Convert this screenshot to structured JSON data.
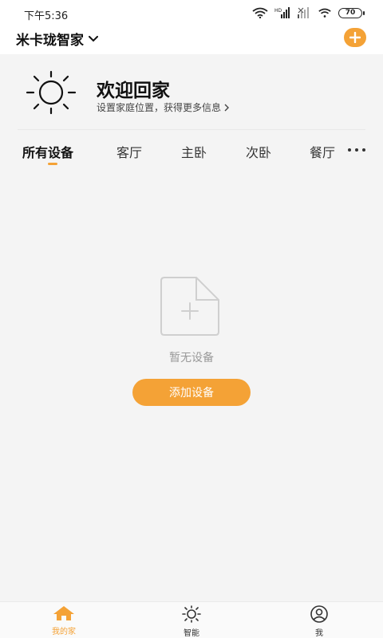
{
  "status_bar": {
    "time": "下午5:36",
    "battery": "70"
  },
  "header": {
    "home_name": "米卡珑智家"
  },
  "welcome": {
    "title": "欢迎回家",
    "subtitle": "设置家庭位置，获得更多信息"
  },
  "tabs": [
    {
      "label": "所有设备",
      "active": true
    },
    {
      "label": "客厅",
      "active": false
    },
    {
      "label": "主卧",
      "active": false
    },
    {
      "label": "次卧",
      "active": false
    },
    {
      "label": "餐厅",
      "active": false
    }
  ],
  "empty_state": {
    "message": "暂无设备",
    "button_label": "添加设备"
  },
  "bottom_nav": [
    {
      "label": "我的家",
      "icon": "home-icon",
      "active": true
    },
    {
      "label": "智能",
      "icon": "sun-icon",
      "active": false
    },
    {
      "label": "我",
      "icon": "user-icon",
      "active": false
    }
  ],
  "colors": {
    "accent": "#f4a236",
    "background": "#f4f4f4",
    "header_bg": "#ffffff"
  }
}
